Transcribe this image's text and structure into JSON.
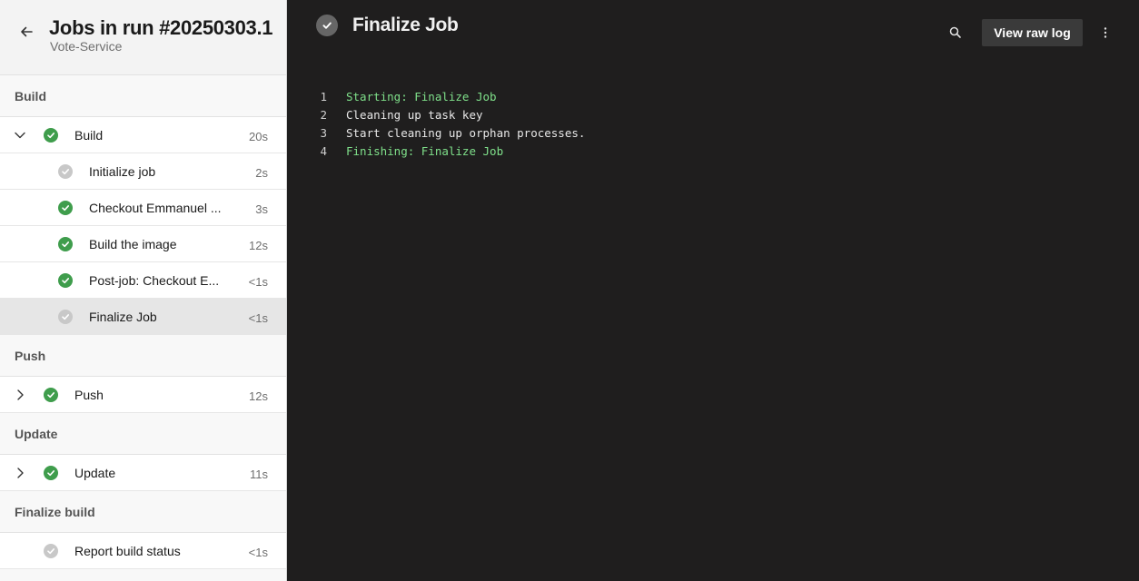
{
  "header": {
    "title": "Jobs in run #20250303.1",
    "subtitle": "Vote-Service"
  },
  "sections": [
    {
      "label": "Build",
      "jobs": [
        {
          "label": "Build",
          "duration": "20s",
          "status": "success",
          "expanded": true,
          "steps": [
            {
              "label": "Initialize job",
              "duration": "2s",
              "status": "skipped"
            },
            {
              "label": "Checkout Emmanuel ...",
              "duration": "3s",
              "status": "success"
            },
            {
              "label": "Build the image",
              "duration": "12s",
              "status": "success"
            },
            {
              "label": "Post-job: Checkout E...",
              "duration": "<1s",
              "status": "success"
            },
            {
              "label": "Finalize Job",
              "duration": "<1s",
              "status": "skipped",
              "selected": true
            }
          ]
        }
      ]
    },
    {
      "label": "Push",
      "jobs": [
        {
          "label": "Push",
          "duration": "12s",
          "status": "success",
          "expanded": false
        }
      ]
    },
    {
      "label": "Update",
      "jobs": [
        {
          "label": "Update",
          "duration": "11s",
          "status": "success",
          "expanded": false
        }
      ]
    },
    {
      "label": "Finalize build",
      "jobs": [
        {
          "label": "Report build status",
          "duration": "<1s",
          "status": "skipped",
          "expanded": null
        }
      ]
    }
  ],
  "main": {
    "title": "Finalize Job",
    "raw_log_label": "View raw log",
    "log_lines": [
      {
        "n": "1",
        "text": "Starting: Finalize Job",
        "color": "#7fe08a"
      },
      {
        "n": "2",
        "text": "Cleaning up task key",
        "color": "#e8e8e8"
      },
      {
        "n": "3",
        "text": "Start cleaning up orphan processes.",
        "color": "#e8e8e8"
      },
      {
        "n": "4",
        "text": "Finishing: Finalize Job",
        "color": "#7fe08a"
      }
    ]
  },
  "icons": {
    "back": "arrow-left-icon",
    "expand": "chevron-icon",
    "success": "check-circle-icon",
    "search": "search-icon",
    "more": "more-vertical-icon"
  },
  "colors": {
    "success": "#3f9d4c",
    "skipped": "#c8c8c8",
    "log_green": "#7fe08a"
  }
}
